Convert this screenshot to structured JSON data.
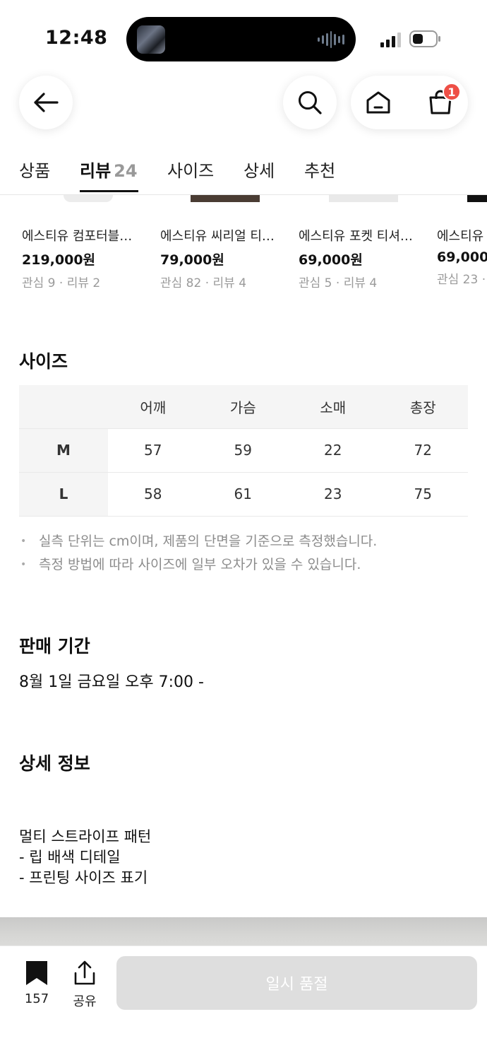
{
  "status_bar": {
    "time": "12:48"
  },
  "header": {
    "cart_badge": "1"
  },
  "tabs": [
    {
      "label": "상품"
    },
    {
      "label": "리뷰",
      "count": "24"
    },
    {
      "label": "사이즈"
    },
    {
      "label": "상세"
    },
    {
      "label": "추천"
    }
  ],
  "recommended": [
    {
      "name": "에스티유 컴포터블…",
      "price": "219,000원",
      "meta": "관심 9 · 리뷰 2"
    },
    {
      "name": "에스티유 씨리얼 티…",
      "price": "79,000원",
      "meta": "관심 82 · 리뷰 4"
    },
    {
      "name": "에스티유 포켓 티셔…",
      "price": "69,000원",
      "meta": "관심 5 · 리뷰 4"
    },
    {
      "name": "에스티유",
      "price": "69,000",
      "meta": "관심 23 ·"
    }
  ],
  "size_section": {
    "title": "사이즈",
    "columns": [
      "어깨",
      "가슴",
      "소매",
      "총장"
    ],
    "rows": [
      {
        "size": "M",
        "values": [
          "57",
          "59",
          "22",
          "72"
        ]
      },
      {
        "size": "L",
        "values": [
          "58",
          "61",
          "23",
          "75"
        ]
      }
    ],
    "notes": [
      "실측 단위는 cm이며, 제품의 단면을 기준으로 측정했습니다.",
      "측정 방법에 따라 사이즈에 일부 오차가 있을 수 있습니다."
    ]
  },
  "sale_section": {
    "title": "판매 기간",
    "period": "8월 1일 금요일 오후 7:00 -"
  },
  "detail_section": {
    "title": "상세 정보",
    "lines": [
      "멀티 스트라이프 패턴",
      "- 립 배색 디테일",
      "- 프린팅 사이즈 표기"
    ]
  },
  "bottom_bar": {
    "bookmark_count": "157",
    "share_label": "공유",
    "cta_label": "일시 품절"
  }
}
